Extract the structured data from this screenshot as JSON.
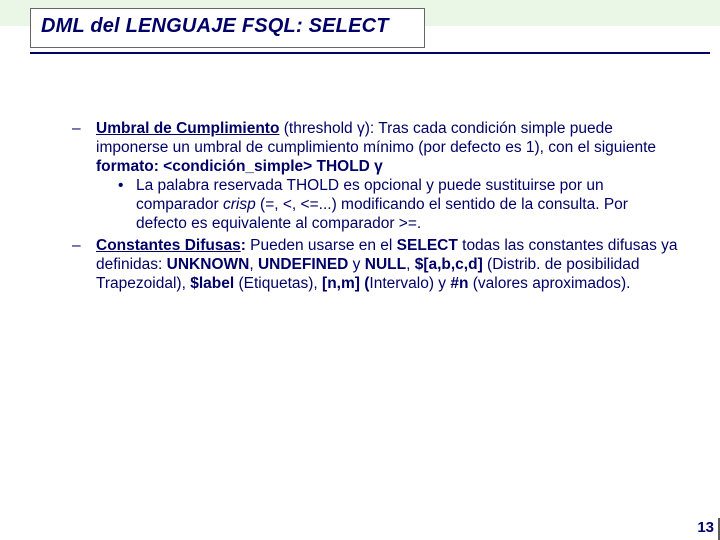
{
  "title_line": "DML del  LENGUAJE  FSQL: SELECT",
  "bullets": [
    {
      "term": "Umbral de Cumplimiento",
      "after_term": " (threshold γ): ",
      "tail1": "Tras cada condición simple puede imponerse un umbral de cumplimiento mínimo (por defecto es 1), con el siguiente ",
      "bold_tail": "formato:  <condición_simple> THOLD γ",
      "sub": {
        "lead": "La palabra reservada THOLD es opcional y puede sustituirse por un comparador ",
        "italic_word": "crisp",
        "after_italic": " (=, <, <=...) modificando el sentido de la consulta. Por defecto es equivalente al comparador >=."
      }
    },
    {
      "term": "Constantes Difusas",
      "after_term": ": ",
      "tail1": "Pueden usarse en el ",
      "bold1": "SELECT",
      "mid1": " todas las constantes difusas ya definidas: ",
      "bold2": "UNKNOWN",
      "sep2": ", ",
      "bold3": "UNDEFINED",
      "sep3": " y ",
      "bold4": "NULL",
      "sep4": ", ",
      "bold5": "$[a,b,c,d]",
      "mid5": " (Distrib. de posibilidad Trapezoidal), ",
      "bold6": "$label",
      "mid6": " (Etiquetas), ",
      "bold7": "[n,m] (",
      "mid7": "Intervalo) y ",
      "bold8": "#n",
      "mid8": " (valores aproximados)."
    }
  ],
  "page_number": "13"
}
